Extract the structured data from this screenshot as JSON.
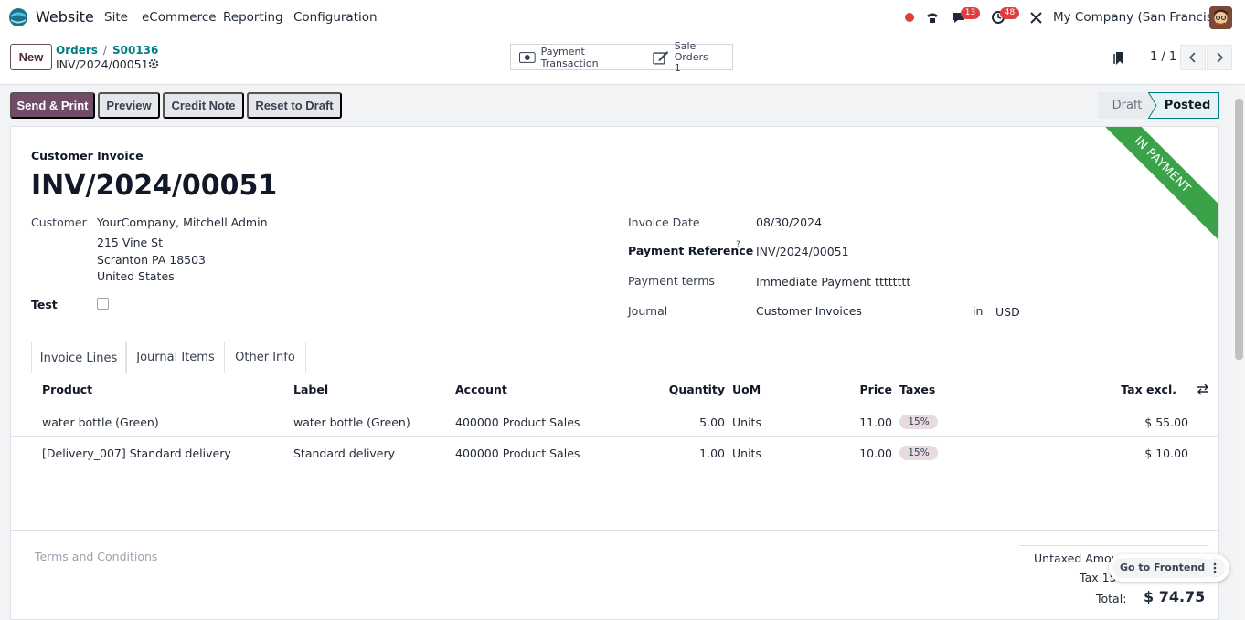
{
  "app": {
    "name": "Website",
    "menu": [
      "Site",
      "eCommerce",
      "Reporting",
      "Configuration"
    ],
    "messages_count": "13",
    "activities_count": "48",
    "company": "My Company (San Francisco)"
  },
  "control_panel": {
    "new_label": "New",
    "breadcrumb": [
      "Orders",
      "S00136"
    ],
    "record_name": "INV/2024/00051",
    "smart_buttons": {
      "payment_transaction": "Payment Transaction",
      "sale_orders_label": "Sale Orders",
      "sale_orders_count": "1"
    },
    "pager": "1 / 1"
  },
  "actions": {
    "send_print": "Send & Print",
    "preview": "Preview",
    "credit_note": "Credit Note",
    "reset_to_draft": "Reset to Draft"
  },
  "statusbar": {
    "draft": "Draft",
    "posted": "Posted"
  },
  "invoice": {
    "type_label": "Customer Invoice",
    "number": "INV/2024/00051",
    "ribbon": "IN PAYMENT",
    "customer_label": "Customer",
    "customer_name": "YourCompany, Mitchell Admin",
    "address": [
      "215 Vine St",
      "Scranton PA 18503",
      "United States"
    ],
    "test_label": "Test",
    "test_checked": false,
    "invoice_date_label": "Invoice Date",
    "invoice_date": "08/30/2024",
    "payment_reference_label": "Payment Reference",
    "payment_reference_help": "?",
    "payment_reference": "INV/2024/00051",
    "payment_terms_label": "Payment terms",
    "payment_terms": "Immediate Payment tttttttt",
    "journal_label": "Journal",
    "journal": "Customer Invoices",
    "journal_in": "in",
    "currency": "USD"
  },
  "tabs": [
    "Invoice Lines",
    "Journal Items",
    "Other Info"
  ],
  "lines": {
    "headers": {
      "product": "Product",
      "label": "Label",
      "account": "Account",
      "quantity": "Quantity",
      "uom": "UoM",
      "price": "Price",
      "taxes": "Taxes",
      "tax_excl": "Tax excl."
    },
    "rows": [
      {
        "product": "water bottle (Green)",
        "label": "water bottle (Green)",
        "account": "400000 Product Sales",
        "quantity": "5.00",
        "uom": "Units",
        "price": "11.00",
        "tax": "15%",
        "subtotal": "$ 55.00"
      },
      {
        "product": "[Delivery_007] Standard delivery",
        "label": "Standard delivery",
        "account": "400000 Product Sales",
        "quantity": "1.00",
        "uom": "Units",
        "price": "10.00",
        "tax": "15%",
        "subtotal": "$ 10.00"
      }
    ]
  },
  "footer": {
    "terms": "Terms and Conditions",
    "untaxed_label": "Untaxed Amou",
    "tax_label": "Tax 15",
    "total_label": "Total:",
    "total_value": "$ 74.75"
  },
  "floating": {
    "go_to_frontend": "Go to Frontend"
  },
  "colors": {
    "brand": "#714b67",
    "link": "#017e84",
    "ribbon": "#3aa248",
    "badge": "#e03e3e"
  }
}
